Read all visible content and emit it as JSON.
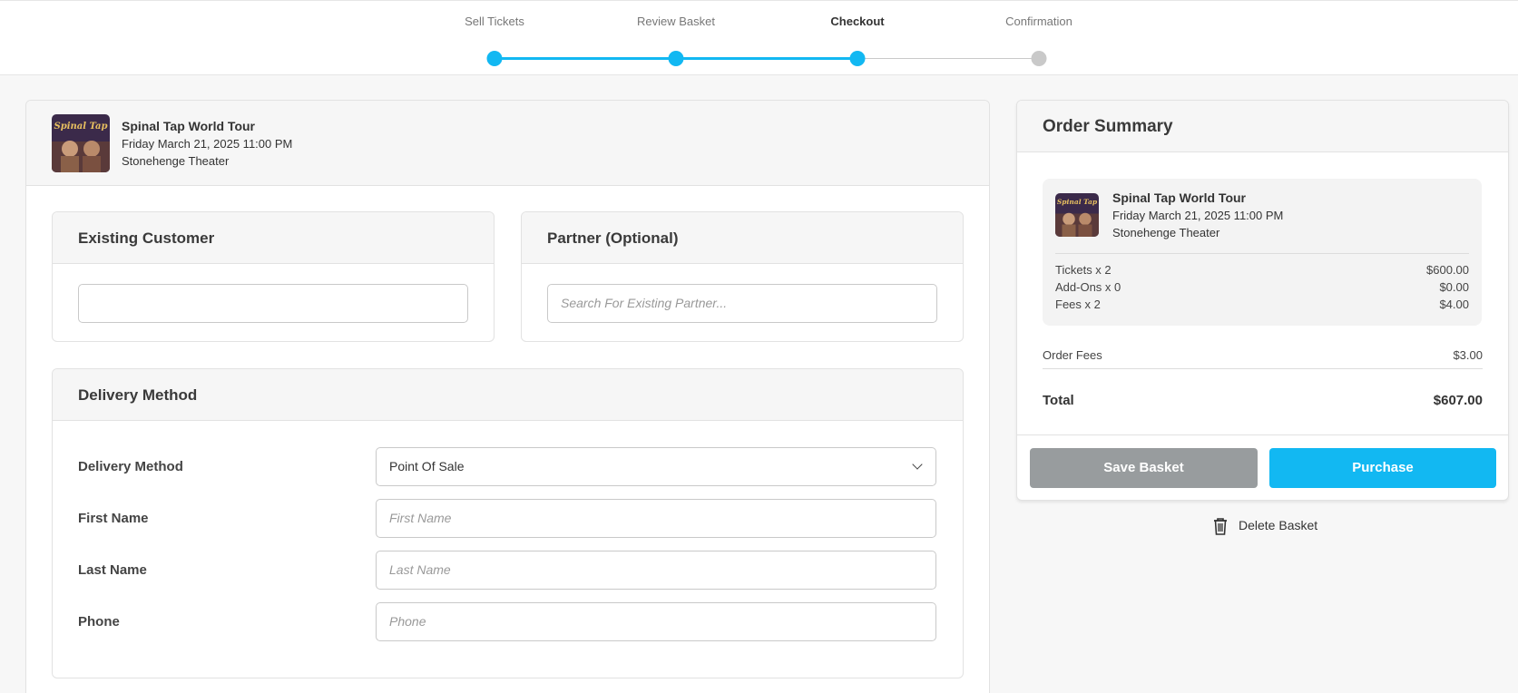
{
  "stepper": {
    "steps": [
      {
        "label": "Sell Tickets",
        "state": "done"
      },
      {
        "label": "Review Basket",
        "state": "done"
      },
      {
        "label": "Checkout",
        "state": "active"
      },
      {
        "label": "Confirmation",
        "state": "pending"
      }
    ],
    "accent_color": "#12b8f2"
  },
  "event": {
    "title": "Spinal Tap World Tour",
    "date": "Friday March 21, 2025 11:00 PM",
    "venue": "Stonehenge Theater",
    "poster_text": "Spinal Tap"
  },
  "existing_customer": {
    "title": "Existing Customer",
    "value": ""
  },
  "partner": {
    "title": "Partner (Optional)",
    "placeholder": "Search For Existing Partner..."
  },
  "delivery": {
    "title": "Delivery Method",
    "method_label": "Delivery Method",
    "method_value": "Point Of Sale",
    "first_name_label": "First Name",
    "first_name_placeholder": "First Name",
    "last_name_label": "Last Name",
    "last_name_placeholder": "Last Name",
    "phone_label": "Phone",
    "phone_placeholder": "Phone"
  },
  "summary": {
    "title": "Order Summary",
    "lines": [
      {
        "label": "Tickets x 2",
        "value": "$600.00"
      },
      {
        "label": "Add-Ons x 0",
        "value": "$0.00"
      },
      {
        "label": "Fees x 2",
        "value": "$4.00"
      }
    ],
    "order_fees_label": "Order Fees",
    "order_fees_value": "$3.00",
    "total_label": "Total",
    "total_value": "$607.00",
    "save_label": "Save Basket",
    "purchase_label": "Purchase",
    "delete_label": "Delete Basket"
  }
}
